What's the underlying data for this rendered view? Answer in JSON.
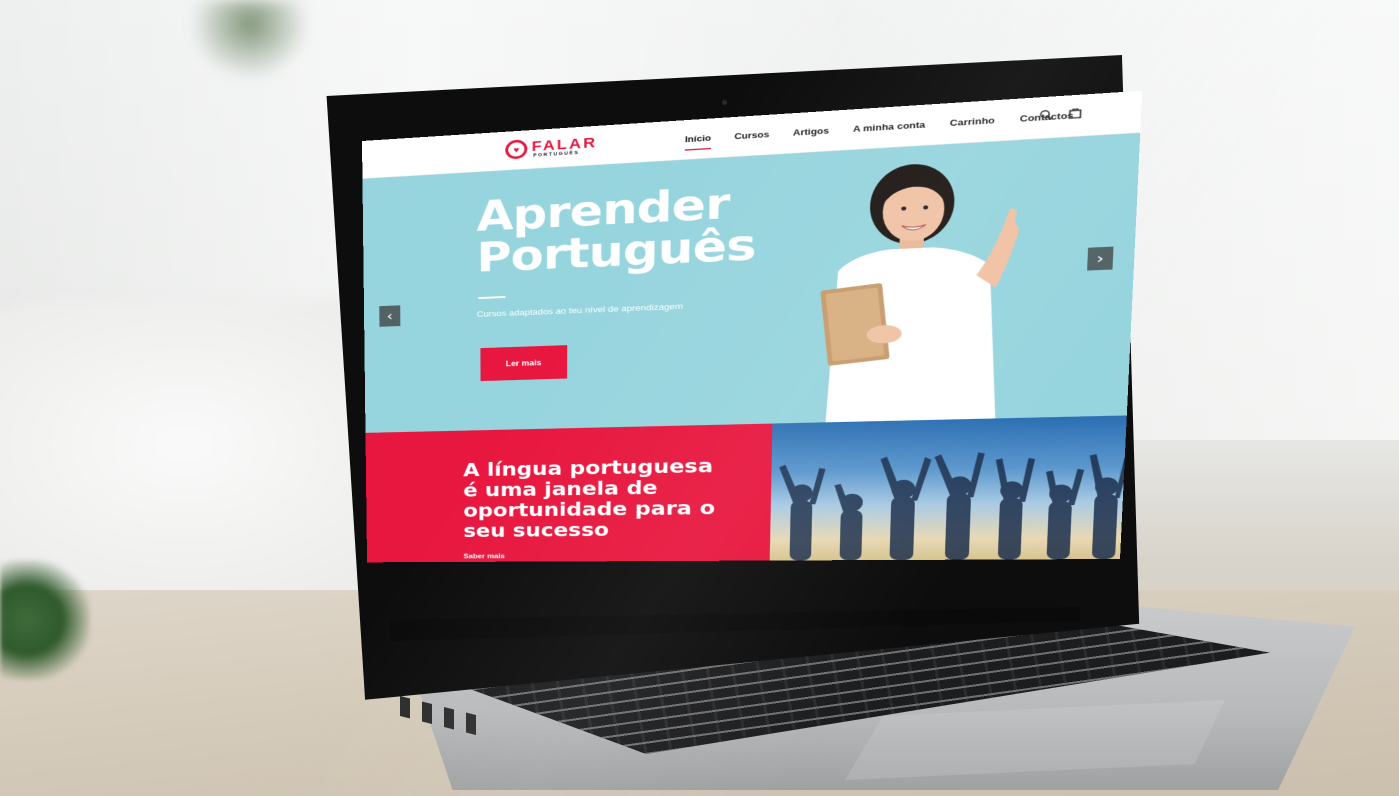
{
  "site": {
    "brand": "FALAR",
    "brand_sub": "PORTUGUÊS",
    "nav": {
      "items": [
        "Início",
        "Cursos",
        "Artigos",
        "A minha conta",
        "Carrinho",
        "Contactos"
      ],
      "active": "Início"
    },
    "hero": {
      "title_line1": "Aprender",
      "title_line2": "Português",
      "subtitle": "Cursos adaptados ao teu nível de aprendizagem",
      "button_label": "Ler mais",
      "prev_arrow": "‹",
      "next_arrow": "›"
    },
    "promo": {
      "title_line1": "A língua portuguesa",
      "title_line2": "é uma janela de",
      "title_line3": "oportunidade para o",
      "title_line4": "seu sucesso",
      "link_label": "Saber mais"
    }
  },
  "colors": {
    "accent": "#e8173f",
    "hero_bg": "#97d5de",
    "nav_bg": "#ffffff"
  },
  "icons": {
    "logo": "chat-heart-icon",
    "search": "search-icon",
    "cart": "cart-icon",
    "prev": "chevron-left-icon",
    "next": "chevron-right-icon"
  }
}
